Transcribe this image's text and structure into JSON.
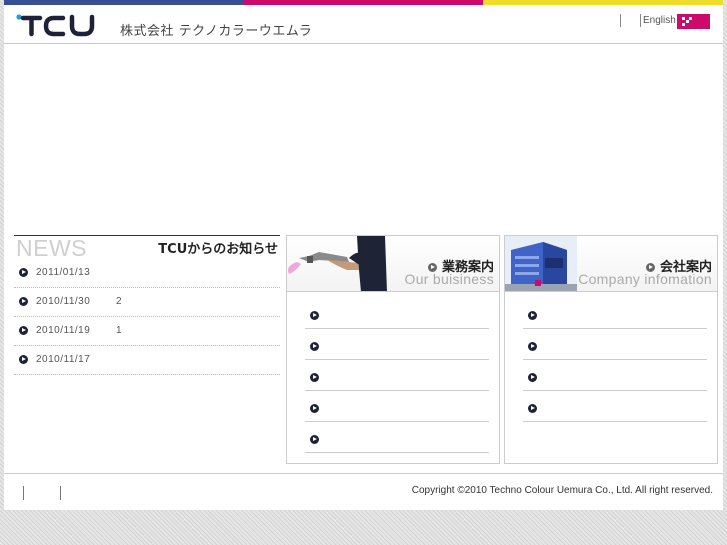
{
  "header": {
    "logo_text": "TCU",
    "company_name": "株式会社 テクノカラーウエムラ",
    "english_link": "English",
    "topbar_colors": [
      "#3a4e96",
      "#cc0a6c",
      "#f0dc2a"
    ]
  },
  "news": {
    "heading_en": "NEWS",
    "heading_jp": "TCUからのお知らせ",
    "items": [
      {
        "date": "2011/01/13",
        "title": ""
      },
      {
        "date": "2010/11/30",
        "title": "2"
      },
      {
        "date": "2010/11/19",
        "title": "1"
      },
      {
        "date": "2010/11/17",
        "title": ""
      }
    ]
  },
  "business": {
    "title": "業務案内",
    "subtitle": "Our buisiness",
    "icon": "spray-gun-photo",
    "item_count": 5
  },
  "company": {
    "title": "会社案内",
    "subtitle": "Company infomation",
    "icon": "building-photo",
    "item_count": 4
  },
  "footer": {
    "copyright": "Copyright ©2010 Techno Colour Uemura Co., Ltd. All right reserved."
  },
  "colors": {
    "accent": "#cc0a6c",
    "navy": "#1e2238",
    "logo_cyan": "#1aa3cf"
  }
}
